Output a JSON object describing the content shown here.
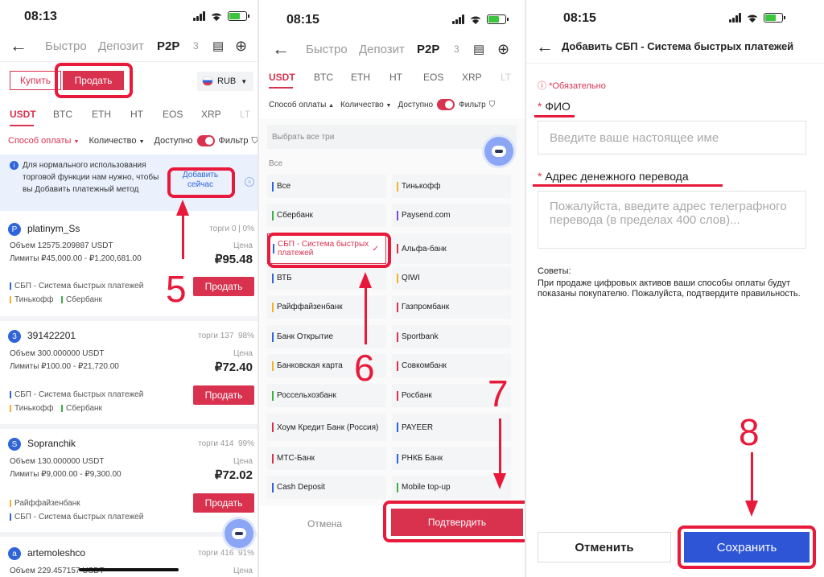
{
  "panel1": {
    "time": "08:13",
    "nav": [
      "Быстро",
      "Депозит",
      "P2P",
      "3"
    ],
    "buy_label": "Купить",
    "sell_label": "Продать",
    "currency": "RUB",
    "tokens": [
      "USDT",
      "BTC",
      "ETH",
      "HT",
      "EOS",
      "XRP",
      "LT"
    ],
    "filters": {
      "payment": "Способ оплаты",
      "amount": "Количество",
      "available": "Доступно",
      "filter": "Фильтр"
    },
    "notice": "Для нормального использования торговой функции нам нужно, чтобы вы Добавить платежный метод",
    "add_now": "Добавить сейчас",
    "step": "5",
    "traders": [
      {
        "initial": "P",
        "name": "platinym_Ss",
        "trades": "торги 0",
        "rate": "0%",
        "volume": "Объем 12575.209887 USDT",
        "limits": "Лимиты ₽45,000.00 - ₽1,200,681.00",
        "price_label": "Цена",
        "price": "₽95.48",
        "methods": [
          {
            "name": "СБП - Система быстрых платежей",
            "color": "#2f65d9"
          },
          {
            "name": "Тинькофф",
            "color": "#f0b429"
          },
          {
            "name": "Сбербанк",
            "color": "#3cb043"
          }
        ],
        "sell": "Продать"
      },
      {
        "initial": "3",
        "name": "391422201",
        "trades": "торги 137",
        "rate": "98%",
        "volume": "Объем 300.000000 USDT",
        "limits": "Лимиты ₽100.00 - ₽21,720.00",
        "price_label": "Цена",
        "price": "₽72.40",
        "methods": [
          {
            "name": "СБП - Система быстрых платежей",
            "color": "#2f65d9"
          },
          {
            "name": "Тинькофф",
            "color": "#f0b429"
          },
          {
            "name": "Сбербанк",
            "color": "#3cb043"
          }
        ],
        "sell": "Продать"
      },
      {
        "initial": "S",
        "name": "Sopranchik",
        "trades": "торги 414",
        "rate": "99%",
        "volume": "Объем 130.000000 USDT",
        "limits": "Лимиты ₽9,000.00 - ₽9,300.00",
        "price_label": "Цена",
        "price": "₽72.02",
        "methods": [
          {
            "name": "Райффайзенбанк",
            "color": "#f0b429"
          },
          {
            "name": "СБП - Система быстрых платежей",
            "color": "#2f65d9"
          }
        ],
        "sell": "Продать"
      },
      {
        "initial": "a",
        "name": "artemoleshco",
        "trades": "торги 416",
        "rate": "91%",
        "volume": "Объем 229.457157 USDT",
        "limits": "",
        "price_label": "Цена",
        "price": "",
        "methods": [],
        "sell": ""
      }
    ]
  },
  "panel2": {
    "time": "08:15",
    "nav": [
      "Быстро",
      "Депозит",
      "P2P",
      "3"
    ],
    "tokens": [
      "USDT",
      "BTC",
      "ETH",
      "HT",
      "EOS",
      "XRP",
      "LT"
    ],
    "filters": {
      "payment": "Способ оплаты",
      "amount": "Количество",
      "available": "Доступно",
      "filter": "Фильтр"
    },
    "select_all": "Выбрать все три",
    "all_label": "Все",
    "banks": [
      {
        "name": "Все",
        "color": "#2f65d9"
      },
      {
        "name": "Тинькофф",
        "color": "#f0b429"
      },
      {
        "name": "Сбербанк",
        "color": "#3cb043"
      },
      {
        "name": "Paysend.com",
        "color": "#7b4dd6"
      },
      {
        "name": "СБП - Система быстрых платежей",
        "color": "#2f65d9",
        "selected": true
      },
      {
        "name": "Альфа-банк",
        "color": "#d8324f"
      },
      {
        "name": "ВТБ",
        "color": "#2f65d9"
      },
      {
        "name": "QIWI",
        "color": "#f0b429"
      },
      {
        "name": "Райффайзенбанк",
        "color": "#f0b429"
      },
      {
        "name": "Газпромбанк",
        "color": "#d8324f"
      },
      {
        "name": "Банк Открытие",
        "color": "#2f65d9"
      },
      {
        "name": "Sportbank",
        "color": "#d8324f"
      },
      {
        "name": "Банковская карта",
        "color": "#f0b429"
      },
      {
        "name": "Совкомбанк",
        "color": "#d8324f"
      },
      {
        "name": "Россельхозбанк",
        "color": "#3cb043"
      },
      {
        "name": "Росбанк",
        "color": "#d8324f"
      },
      {
        "name": "Хоум Кредит Банк (Россия)",
        "color": "#d8324f"
      },
      {
        "name": "PAYEER",
        "color": "#2f65d9"
      },
      {
        "name": "МТС-Банк",
        "color": "#d8324f"
      },
      {
        "name": "РНКБ Банк",
        "color": "#2f65d9"
      },
      {
        "name": "Cash Deposit",
        "color": "#2f65d9"
      },
      {
        "name": "Mobile top-up",
        "color": "#3cb043"
      }
    ],
    "cancel": "Отмена",
    "confirm": "Подтвердить",
    "step6": "6",
    "step7": "7"
  },
  "panel3": {
    "time": "08:15",
    "title": "Добавить СБП - Система быстрых платежей",
    "required_note": "*Обязательно",
    "name_label": "ФИО",
    "name_placeholder": "Введите ваше настоящее име",
    "address_label": "Адрес денежного перевода",
    "address_placeholder": "Пожалуйста, введите адрес телеграфного перевода (в пределах 400 слов)...",
    "tips_title": "Советы:",
    "tips_text": "При продаже цифровых активов ваши способы оплаты будут показаны покупателю. Пожалуйста, подтвердите правильность.",
    "cancel": "Отменить",
    "save": "Сохранить",
    "step": "8"
  },
  "colors": {
    "accent": "#d8324f",
    "annotation": "#e8193a",
    "save": "#2e55d6"
  }
}
